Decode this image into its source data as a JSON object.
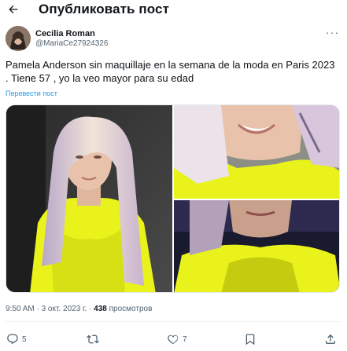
{
  "header": {
    "title": "Опубликовать пост",
    "back_icon": "arrow-left-icon"
  },
  "author": {
    "name": "Cecilia Roman",
    "handle": "@MariaCe27924326",
    "more_icon": "more-horizontal-icon"
  },
  "post": {
    "text": "Pamela Anderson sin maquillaje en la semana de la moda en Paris 2023 . Tiene 57 , yo la veo mayor para su edad",
    "translate": "Перевести пост"
  },
  "media": {
    "photo_count": 3,
    "colors": {
      "dress": "#e9f21a",
      "hair": "#e0c9c9",
      "skin": "#e8c2aa",
      "background": "#3a3a3a"
    }
  },
  "meta": {
    "time": "9:50 AM",
    "sep": " · ",
    "date": "3 окт. 2023 г.",
    "views_count": "438",
    "views_label": "просмотров"
  },
  "actions": {
    "reply": {
      "icon": "reply-icon",
      "count": "5"
    },
    "repost": {
      "icon": "repost-icon",
      "count": ""
    },
    "like": {
      "icon": "heart-icon",
      "count": "7"
    },
    "bookmark": {
      "icon": "bookmark-icon"
    },
    "share": {
      "icon": "share-icon"
    }
  }
}
